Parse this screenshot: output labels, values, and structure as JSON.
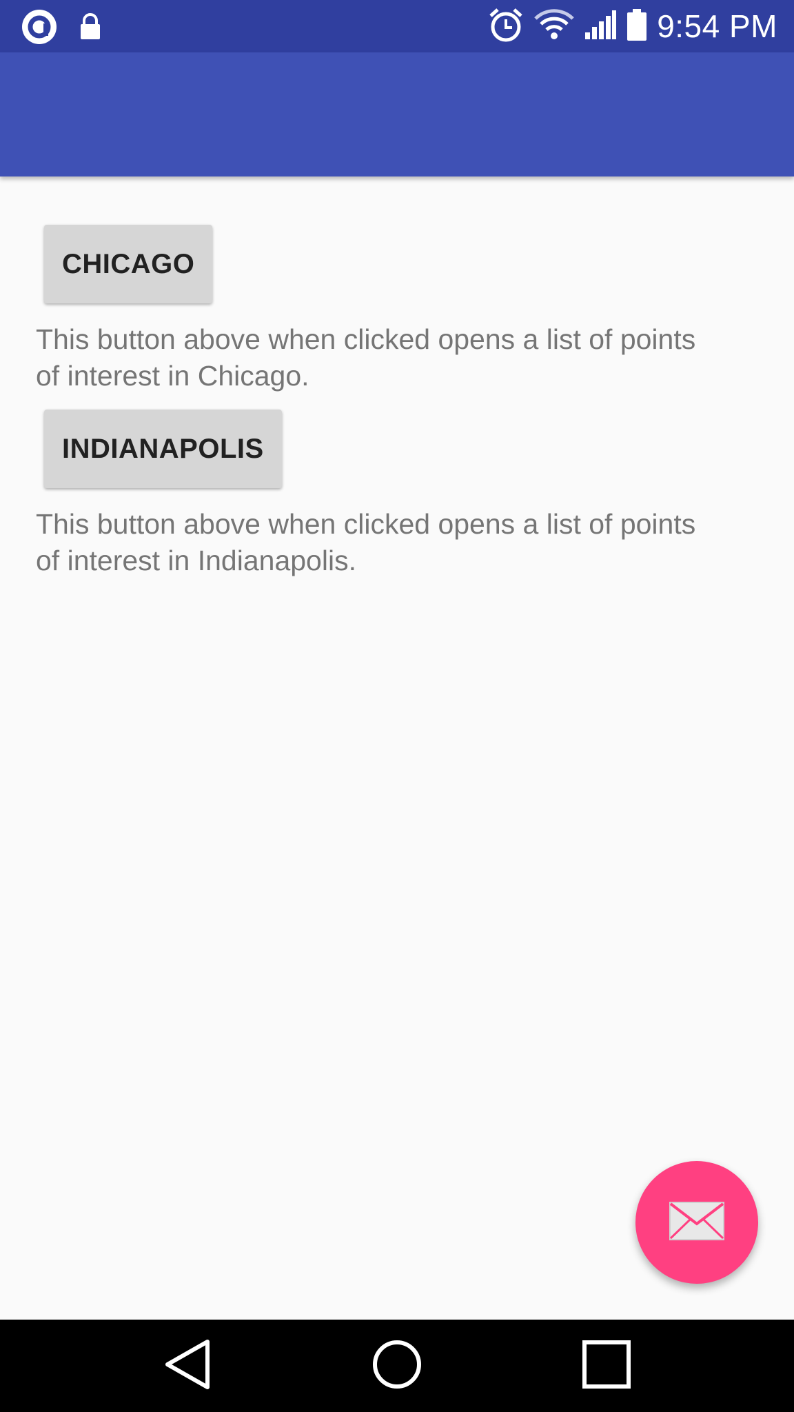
{
  "status_bar": {
    "time": "9:54 PM",
    "left_icons": [
      "app-notification-icon",
      "lock-icon"
    ],
    "right_icons": [
      "alarm-icon",
      "wifi-icon",
      "signal-icon",
      "battery-icon"
    ]
  },
  "colors": {
    "status_bar": "#303f9f",
    "app_bar": "#3f51b5",
    "fab": "#ff4081",
    "background": "#fafafa"
  },
  "main": {
    "buttons": [
      {
        "label": "CHICAGO",
        "description": "This button above when clicked opens a list of points of interest in Chicago."
      },
      {
        "label": "INDIANAPOLIS",
        "description": "This button above when clicked opens a list of points of interest in Indianapolis."
      }
    ]
  },
  "fab": {
    "icon": "email-icon"
  },
  "nav_bar": {
    "icons": [
      "back-icon",
      "home-icon",
      "recents-icon"
    ]
  }
}
